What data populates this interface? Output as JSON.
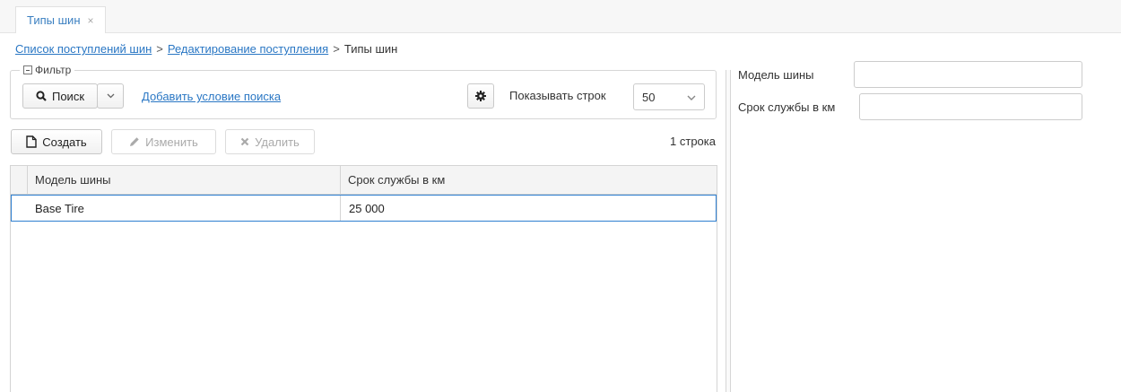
{
  "tab": {
    "label": "Типы шин",
    "close": "×"
  },
  "breadcrumb": {
    "items": [
      "Список поступлений шин",
      "Редактирование поступления"
    ],
    "current": "Типы шин",
    "separator": ">"
  },
  "filter": {
    "legend": "Фильтр",
    "search_label": "Поиск",
    "add_condition": "Добавить условие поиска",
    "show_rows_label": "Показывать строк",
    "rows_per_page": "50"
  },
  "toolbar": {
    "create_label": "Создать",
    "edit_label": "Изменить",
    "delete_label": "Удалить",
    "row_count": "1 строка"
  },
  "table": {
    "columns": [
      "Модель шины",
      "Срок службы в км"
    ],
    "rows": [
      [
        "Base Tire",
        "25 000"
      ]
    ]
  },
  "form": {
    "model_label": "Модель шины",
    "model_value": "",
    "life_label": "Срок службы в км",
    "life_value": ""
  },
  "colors": {
    "link": "#2a77c4",
    "selection_border": "#2e7fd1"
  }
}
